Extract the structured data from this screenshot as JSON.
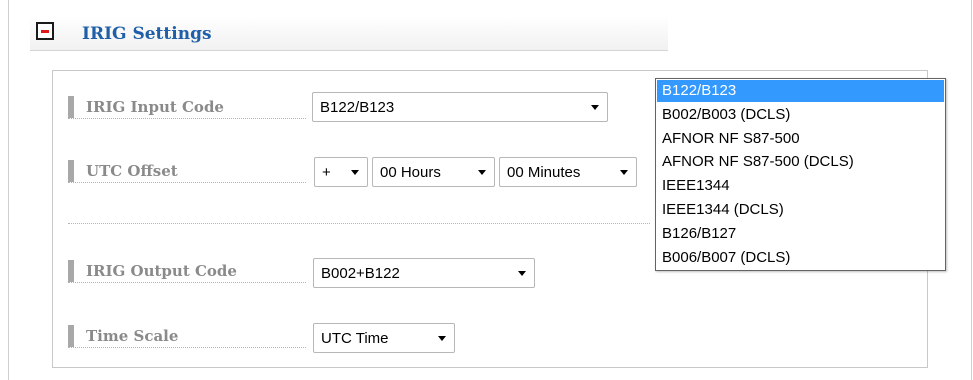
{
  "section": {
    "title": "IRIG Settings"
  },
  "rows": {
    "input_code": {
      "label": "IRIG Input Code",
      "value": "B122/B123"
    },
    "utc_offset": {
      "label": "UTC Offset",
      "sign": "+",
      "hours": "00 Hours",
      "minutes": "00 Minutes"
    },
    "output_code": {
      "label": "IRIG Output Code",
      "value": "B002+B122"
    },
    "time_scale": {
      "label": "Time Scale",
      "value": "UTC Time"
    }
  },
  "dropdown": {
    "selected_index": 0,
    "options": [
      "B122/B123",
      "B002/B003 (DCLS)",
      "AFNOR NF S87-500",
      "AFNOR NF S87-500 (DCLS)",
      "IEEE1344",
      "IEEE1344 (DCLS)",
      "B126/B127",
      "B006/B007 (DCLS)"
    ]
  },
  "colors": {
    "title": "#1f5fa8",
    "label": "#8a8a8a",
    "selected_option_bg": "#3399ff",
    "collapse_minus": "#e01818"
  }
}
